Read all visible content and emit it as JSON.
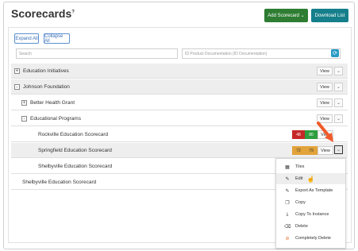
{
  "header": {
    "title": "Scorecards",
    "help_mark": "?",
    "add_label": "Add Scorecard ⌄",
    "download_label": "Download List"
  },
  "toolbar": {
    "expand_label": "Expand All",
    "collapse_label": "Collapse All",
    "search_placeholder": "Search",
    "doc_placeholder": "ID Product Documentation (ID Documentation)"
  },
  "rows": [
    {
      "label": "Education Initiatives",
      "toggle": "+"
    },
    {
      "label": "Johnson Foundation",
      "toggle": "-"
    },
    {
      "label": "Better Health Grant",
      "toggle": "+"
    },
    {
      "label": "Educational Programs",
      "toggle": "-"
    },
    {
      "label": "Rockville Education Scorecard",
      "scores": [
        "48",
        "80"
      ]
    },
    {
      "label": "Springfield Education Scorecard",
      "scores": [
        "72",
        "79"
      ]
    },
    {
      "label": "Shelbyville Education Scorecard"
    },
    {
      "label": "Shelbyville Education Scorecard"
    }
  ],
  "view_label": "View",
  "chevron": "⌄",
  "menu": [
    {
      "label": "Tiles",
      "icon": "tiles-icon",
      "glyph": "▦"
    },
    {
      "label": "Edit",
      "icon": "edit-icon",
      "glyph": "✎"
    },
    {
      "label": "Export As Template",
      "icon": "export-icon",
      "glyph": "✎"
    },
    {
      "label": "Copy",
      "icon": "copy-icon",
      "glyph": "❐"
    },
    {
      "label": "Copy To Instance",
      "icon": "download-icon",
      "glyph": "⤓"
    },
    {
      "label": "Delete",
      "icon": "delete-icon",
      "glyph": "⌫"
    },
    {
      "label": "Completely Delete",
      "icon": "no-entry-icon",
      "glyph": "⊘"
    }
  ],
  "colors": {
    "score_red": "#c62828",
    "score_green": "#2e9e3e",
    "score_orange": "#e2a33a",
    "arrow": "#ef5a2a"
  }
}
